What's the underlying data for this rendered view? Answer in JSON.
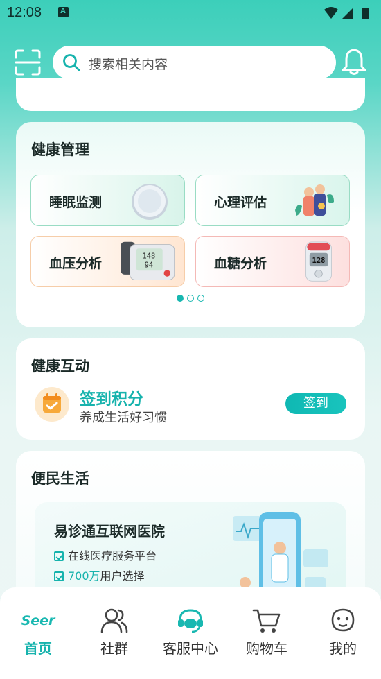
{
  "status_bar": {
    "time": "12:08",
    "notification_glyph": "A"
  },
  "header": {
    "search_placeholder": "搜索相关内容"
  },
  "health_management": {
    "title": "健康管理",
    "tiles": [
      {
        "label": "睡眠监测",
        "icon": "sleep-device-icon"
      },
      {
        "label": "心理评估",
        "icon": "psychology-people-icon"
      },
      {
        "label": "血压分析",
        "icon": "blood-pressure-monitor-icon"
      },
      {
        "label": "血糖分析",
        "icon": "glucose-meter-icon"
      }
    ],
    "page_indicator": {
      "count": 3,
      "active": 0
    },
    "art_text": {
      "bp_top": "148",
      "bp_bottom": "94",
      "glucose": "128"
    }
  },
  "health_interaction": {
    "title": "健康互动",
    "checkin_title": "签到积分",
    "checkin_subtitle": "养成生活好习惯",
    "checkin_button": "签到"
  },
  "convenience_life": {
    "title": "便民生活",
    "banner_title": "易诊通互联网医院",
    "banner_line1": "在线医疗服务平台",
    "banner_line2_highlight": "700万",
    "banner_line2_rest": "用户选择"
  },
  "bottom_nav": {
    "items": [
      {
        "label": "首页",
        "icon_text": "Seer",
        "active": true
      },
      {
        "label": "社群",
        "icon": "people-icon"
      },
      {
        "label": "客服中心",
        "icon": "headset-icon"
      },
      {
        "label": "购物车",
        "icon": "cart-icon"
      },
      {
        "label": "我的",
        "icon": "profile-face-icon"
      }
    ]
  },
  "colors": {
    "accent": "#17b3ad",
    "header_bg": "#3ccfba",
    "checkin_orange": "#f7a93a"
  }
}
